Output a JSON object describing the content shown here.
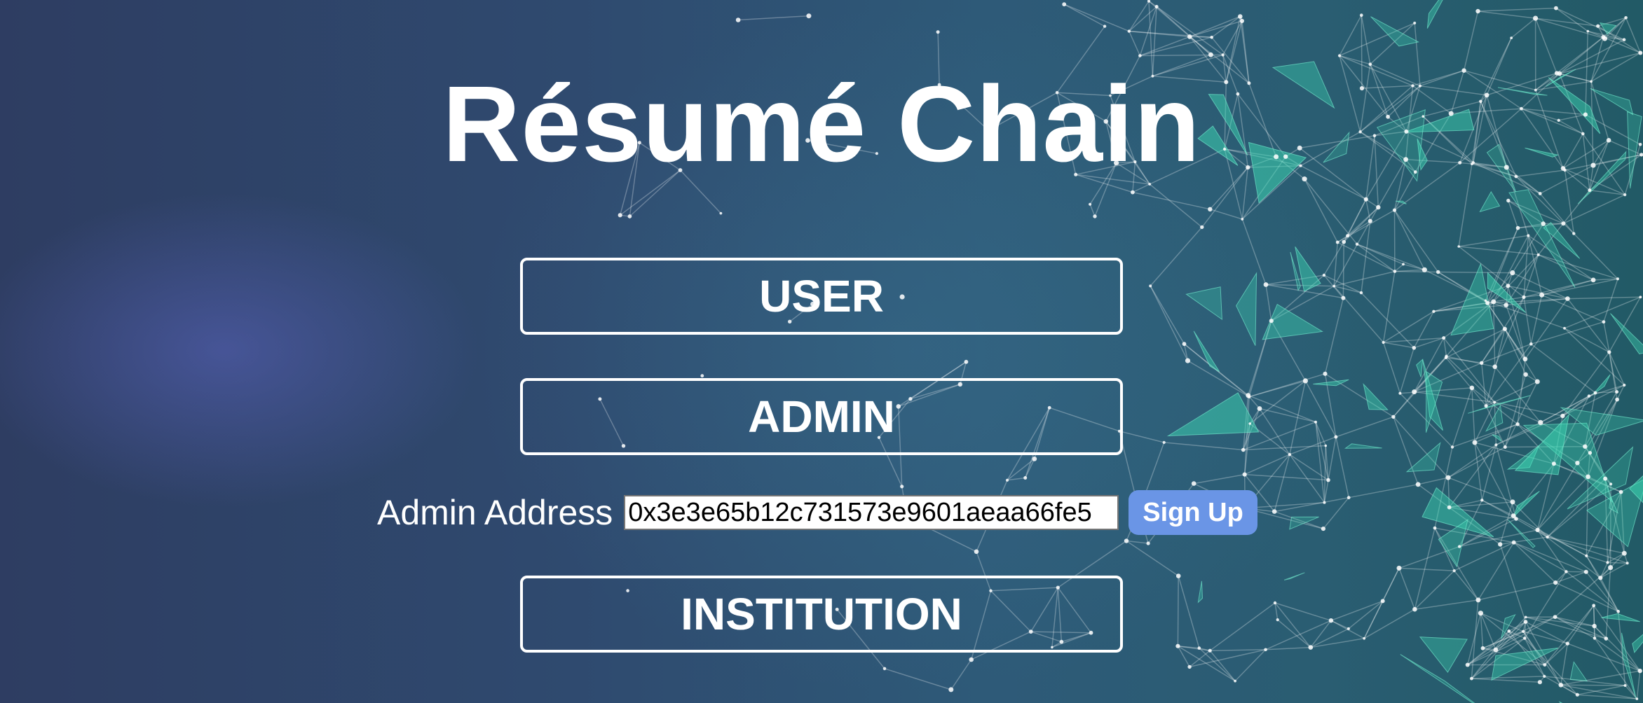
{
  "app": {
    "title": "Résumé Chain"
  },
  "roles": {
    "user_label": "USER",
    "admin_label": "ADMIN",
    "institution_label": "INSTITUTION"
  },
  "admin_signup": {
    "label": "Admin Address",
    "address_value": "0x3e3e65b12c731573e9601aeaa66fe5",
    "button_label": "Sign Up"
  },
  "colors": {
    "signup_button": "#6a95e6",
    "network_accent": "#3ee0b8"
  }
}
